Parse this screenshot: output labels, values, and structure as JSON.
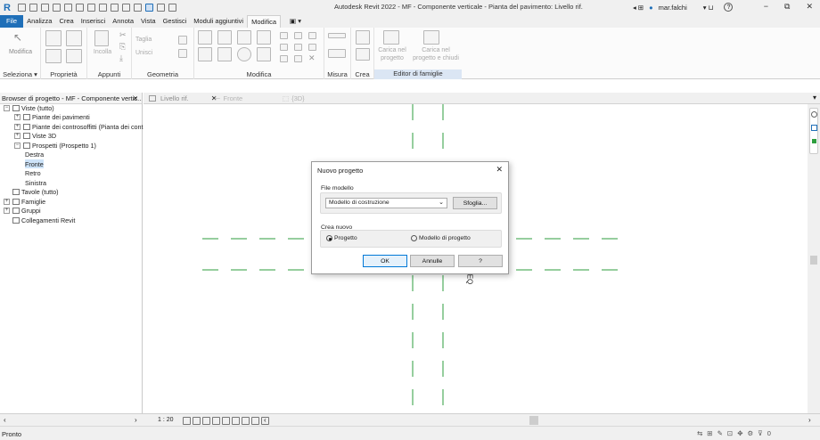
{
  "app": {
    "window_title": "Autodesk Revit 2022 - MF - Componente verticale - Pianta del pavimento: Livello rif.",
    "user": "mar.falchi",
    "help": "?",
    "window_controls": [
      "−",
      "⧉",
      "✕"
    ]
  },
  "ribbon_tabs": [
    "File",
    "Analizza",
    "Crea",
    "Inserisci",
    "Annota",
    "Vista",
    "Gestisci",
    "Moduli aggiuntivi",
    "Modifica",
    "▣ ▾"
  ],
  "active_tab": "Modifica",
  "ribbon": {
    "modifica_label": "Modifica",
    "incolla_label": "Incolla",
    "taglia_label": "Taglia",
    "unisci_label": "Unisci",
    "carica_progetto": "Carica nel progetto",
    "carica_chiudi": "Carica nel progetto e chiudi",
    "panels": [
      "Seleziona ▾",
      "Proprietà",
      "Appunti",
      "Geometria",
      "Modifica",
      "Misura",
      "Crea",
      "Editor di famiglie"
    ]
  },
  "browser": {
    "title": "Browser di progetto - MF - Componente vertic...",
    "close": "✕",
    "tree": [
      {
        "label": "Viste (tutto)",
        "level": 0,
        "toggle": "−"
      },
      {
        "label": "Piante dei pavimenti",
        "level": 1,
        "toggle": "+"
      },
      {
        "label": "Piante dei controsoffitti (Pianta dei contr",
        "level": 1,
        "toggle": "+"
      },
      {
        "label": "Viste 3D",
        "level": 1,
        "toggle": "+"
      },
      {
        "label": "Prospetti (Prospetto 1)",
        "level": 1,
        "toggle": "−"
      },
      {
        "label": "Destra",
        "level": 2,
        "toggle": ""
      },
      {
        "label": "Fronte",
        "level": 2,
        "toggle": "",
        "selected": true
      },
      {
        "label": "Retro",
        "level": 2,
        "toggle": ""
      },
      {
        "label": "Sinistra",
        "level": 2,
        "toggle": ""
      },
      {
        "label": "Tavole (tutto)",
        "level": 0,
        "toggle": ""
      },
      {
        "label": "Famiglie",
        "level": 0,
        "toggle": "+"
      },
      {
        "label": "Gruppi",
        "level": 0,
        "toggle": "+"
      },
      {
        "label": "Collegamenti Revit",
        "level": 0,
        "toggle": ""
      }
    ]
  },
  "view_tabs": [
    {
      "label": "Livello rif.",
      "close": "✕"
    },
    {
      "label": "Fronte",
      "close": ""
    },
    {
      "label": "{3D}",
      "close": ""
    }
  ],
  "view_control": {
    "scale": "1 : 20"
  },
  "status": {
    "text": "Pronto",
    "filter_count": "0"
  },
  "dialog": {
    "title": "Nuovo progetto",
    "close": "✕",
    "template_group": "File modello",
    "template_value": "Modello di costruzione",
    "browse_button": "Sfoglia...",
    "create_group": "Crea nuovo",
    "radio_project": "Progetto",
    "radio_template": "Modello di progetto",
    "ok": "OK",
    "cancel": "Annulle",
    "help": "?"
  },
  "canvas": {
    "ref_label": "EQ"
  },
  "colors": {
    "accent": "#1f6fb8",
    "ref_plane": "#2e9e3e",
    "highlight": "#dbe6f4"
  }
}
